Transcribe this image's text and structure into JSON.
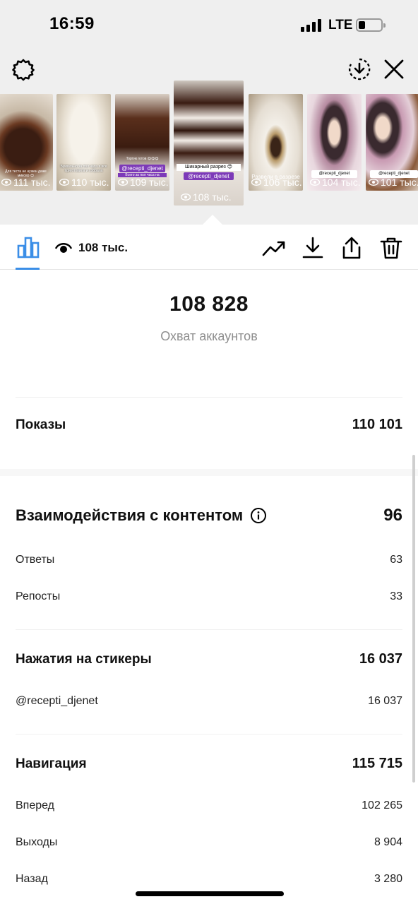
{
  "status": {
    "time": "16:59",
    "network": "LTE"
  },
  "header_icons": [
    "settings-icon",
    "download-circle-icon",
    "close-icon"
  ],
  "stories": [
    {
      "views": "111 тыс.",
      "caption": "Для теста не нужен даже миксер 😊",
      "tag": ""
    },
    {
      "views": "110 тыс.",
      "caption": "Буквально за пол часа я все приготовила и собрала",
      "tag": ""
    },
    {
      "views": "109 тыс.",
      "caption": "Тортик готов 😋😋😋",
      "tag": "@recepti_djenet",
      "caption2": "Всего за пол часа на"
    },
    {
      "views": "108 тыс.",
      "caption": "Шикарный разрез 😊",
      "tag": "@recepti_djenet"
    },
    {
      "views": "106 тыс.",
      "caption": "Развели в разрезе",
      "tag": ""
    },
    {
      "views": "104 тыс.",
      "caption": "",
      "tag": "@recepti_djenet"
    },
    {
      "views": "101 тыс.",
      "caption": "",
      "tag": "@recepti_djenet"
    }
  ],
  "toolbar": {
    "views_label": "108 тыс."
  },
  "reach": {
    "value": "108 828",
    "label": "Охват аккаунтов"
  },
  "impressions": {
    "label": "Показы",
    "value": "110 101"
  },
  "interactions": {
    "label": "Взаимодействия с контентом",
    "value": "96",
    "items": [
      {
        "label": "Ответы",
        "value": "63"
      },
      {
        "label": "Репосты",
        "value": "33"
      }
    ]
  },
  "sticker_taps": {
    "label": "Нажатия на стикеры",
    "value": "16 037",
    "items": [
      {
        "label": "@recepti_djenet",
        "value": "16 037"
      }
    ]
  },
  "navigation": {
    "label": "Навигация",
    "value": "115 715",
    "items": [
      {
        "label": "Вперед",
        "value": "102 265"
      },
      {
        "label": "Выходы",
        "value": "8 904"
      },
      {
        "label": "Назад",
        "value": "3 280"
      }
    ]
  }
}
